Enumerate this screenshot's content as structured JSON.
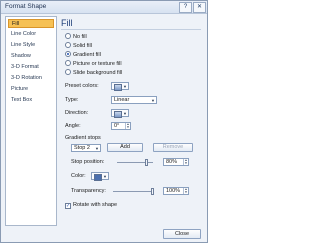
{
  "window": {
    "title": "Format Shape",
    "help_label": "?",
    "close_x_label": "✕"
  },
  "sidebar": {
    "items": [
      {
        "label": "Fill",
        "active": true
      },
      {
        "label": "Line Color"
      },
      {
        "label": "Line Style"
      },
      {
        "label": "Shadow"
      },
      {
        "label": "3-D Format"
      },
      {
        "label": "3-D Rotation"
      },
      {
        "label": "Picture"
      },
      {
        "label": "Text Box"
      }
    ]
  },
  "fill": {
    "heading": "Fill",
    "options": [
      {
        "label": "No fill",
        "selected": false
      },
      {
        "label": "Solid fill",
        "selected": false
      },
      {
        "label": "Gradient fill",
        "selected": true
      },
      {
        "label": "Picture or texture fill",
        "selected": false
      },
      {
        "label": "Slide background fill",
        "selected": false
      }
    ],
    "preset_colors_label": "Preset colors:",
    "type_label": "Type:",
    "type_value": "Linear",
    "direction_label": "Direction:",
    "angle_label": "Angle:",
    "angle_value": "0°",
    "gradient_stops_label": "Gradient stops",
    "stop_value": "Stop 2",
    "add_label": "Add",
    "remove_label": "Remove",
    "stop_position_label": "Stop position:",
    "stop_position_value": "80%",
    "stop_position_fraction": 0.8,
    "color_label": "Color:",
    "transparency_label": "Transparency:",
    "transparency_value": "100%",
    "transparency_fraction": 1.0,
    "rotate_label": "Rotate with shape",
    "rotate_checked": true
  },
  "footer": {
    "close_label": "Close"
  }
}
